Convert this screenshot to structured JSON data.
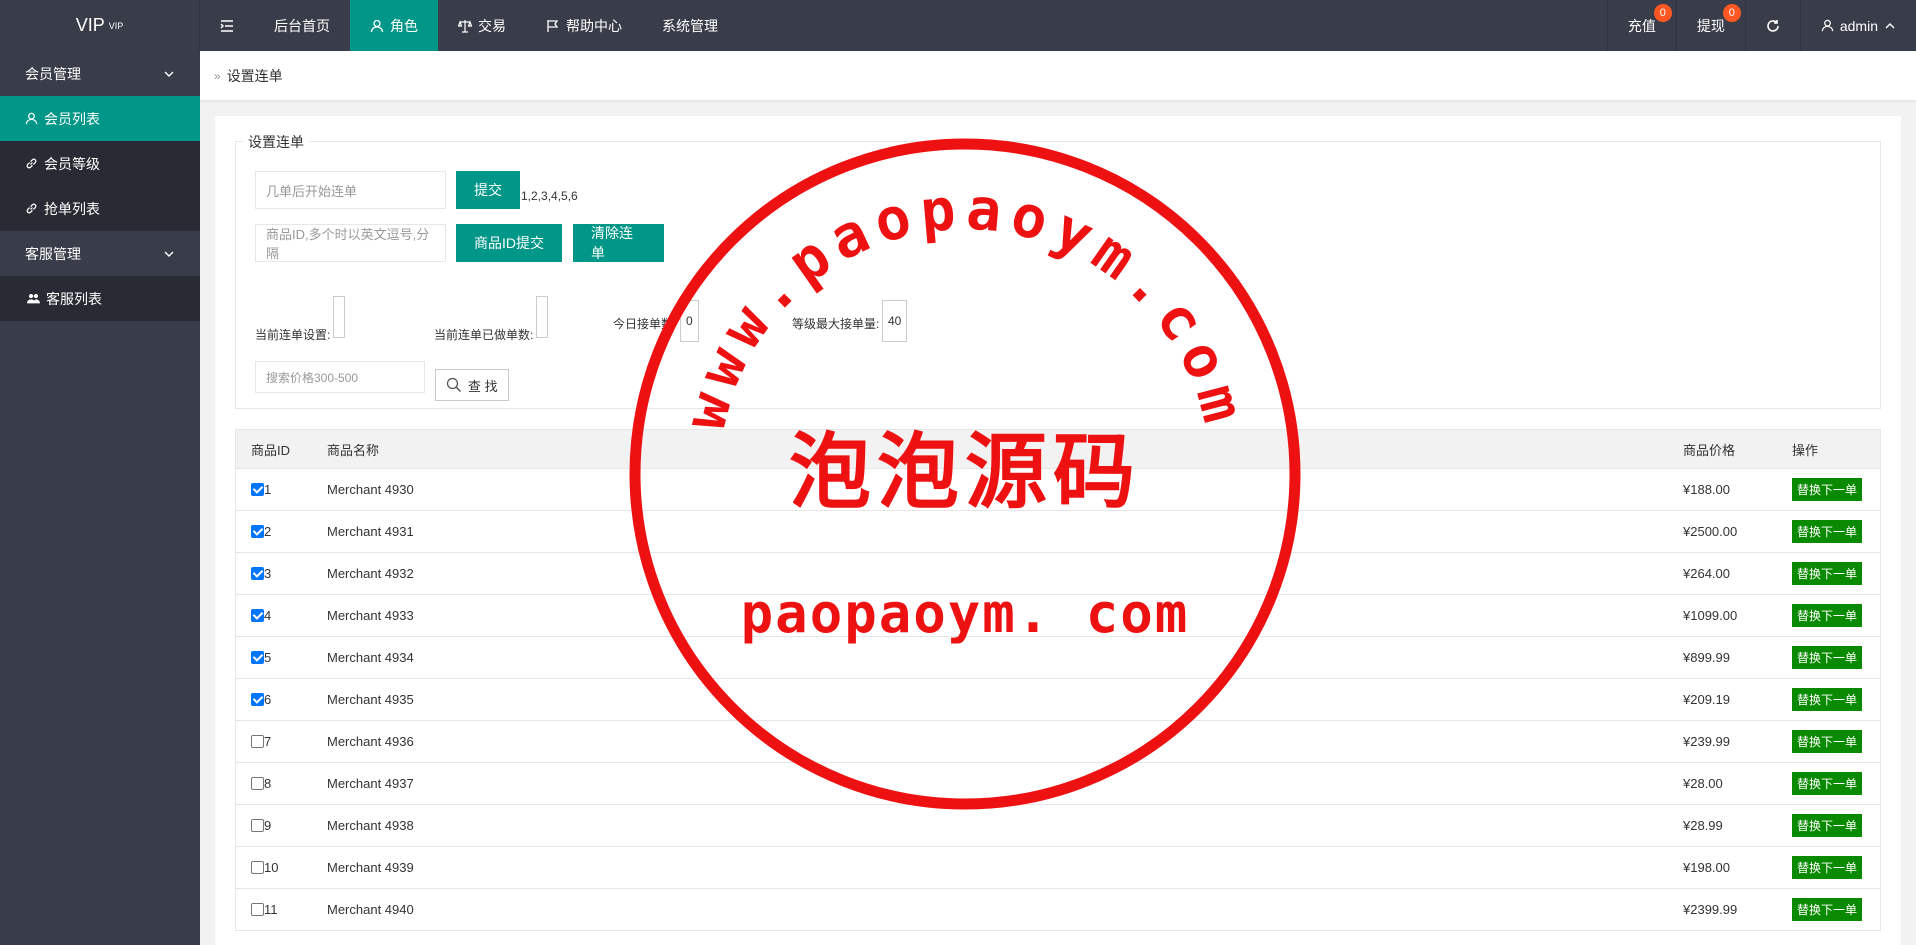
{
  "logo": {
    "text": "VIP",
    "sup": "VIP"
  },
  "nav": {
    "items": [
      {
        "label": "后台首页"
      },
      {
        "label": "角色"
      },
      {
        "label": "交易"
      },
      {
        "label": "帮助中心"
      },
      {
        "label": "系统管理"
      }
    ]
  },
  "right_nav": {
    "recharge": {
      "label": "充值",
      "badge": "0"
    },
    "withdraw": {
      "label": "提现",
      "badge": "0"
    },
    "user": "admin"
  },
  "sidebar": {
    "groups": [
      {
        "label": "会员管理",
        "items": [
          {
            "label": "会员列表"
          },
          {
            "label": "会员等级"
          },
          {
            "label": "抢单列表"
          }
        ]
      },
      {
        "label": "客服管理",
        "items": [
          {
            "label": "客服列表"
          }
        ]
      }
    ]
  },
  "breadcrumb": "设置连单",
  "form": {
    "legend": "设置连单",
    "start_placeholder": "几单后开始连单",
    "submit": "提交",
    "submit_hint": "1,2,3,4,5,6",
    "ids_placeholder": "商品ID,多个时以英文逗号,分隔",
    "ids_submit": "商品ID提交",
    "clear": "清除连单",
    "current_label": "当前连单设置:",
    "done_label": "当前连单已做单数:",
    "today_label": "今日接单数:",
    "today_value": "0",
    "max_label": "等级最大接单量:",
    "max_value": "40",
    "search_placeholder": "搜索价格300-500",
    "search_btn": "查 找"
  },
  "table": {
    "headers": {
      "id": "商品ID",
      "name": "商品名称",
      "price": "商品价格",
      "op": "操作"
    },
    "op_label": "替换下一单",
    "rows": [
      {
        "id": "1",
        "name": "Merchant 4930",
        "price": "¥188.00",
        "checked": true
      },
      {
        "id": "2",
        "name": "Merchant 4931",
        "price": "¥2500.00",
        "checked": true
      },
      {
        "id": "3",
        "name": "Merchant 4932",
        "price": "¥264.00",
        "checked": true
      },
      {
        "id": "4",
        "name": "Merchant 4933",
        "price": "¥1099.00",
        "checked": true
      },
      {
        "id": "5",
        "name": "Merchant 4934",
        "price": "¥899.99",
        "checked": true
      },
      {
        "id": "6",
        "name": "Merchant 4935",
        "price": "¥209.19",
        "checked": true
      },
      {
        "id": "7",
        "name": "Merchant 4936",
        "price": "¥239.99",
        "checked": false
      },
      {
        "id": "8",
        "name": "Merchant 4937",
        "price": "¥28.00",
        "checked": false
      },
      {
        "id": "9",
        "name": "Merchant 4938",
        "price": "¥28.99",
        "checked": false
      },
      {
        "id": "10",
        "name": "Merchant 4939",
        "price": "¥198.00",
        "checked": false
      },
      {
        "id": "11",
        "name": "Merchant 4940",
        "price": "¥2399.99",
        "checked": false
      }
    ]
  },
  "watermark": {
    "arc_text": "www.paopaoym.com",
    "cn_text": "泡泡源码",
    "url_text": "paopaoym. com",
    "color": "#ee1111"
  },
  "colors": {
    "primary": "#009688",
    "dark": "#393d49",
    "op_green": "#0a8a00",
    "badge": "#ff5722"
  }
}
